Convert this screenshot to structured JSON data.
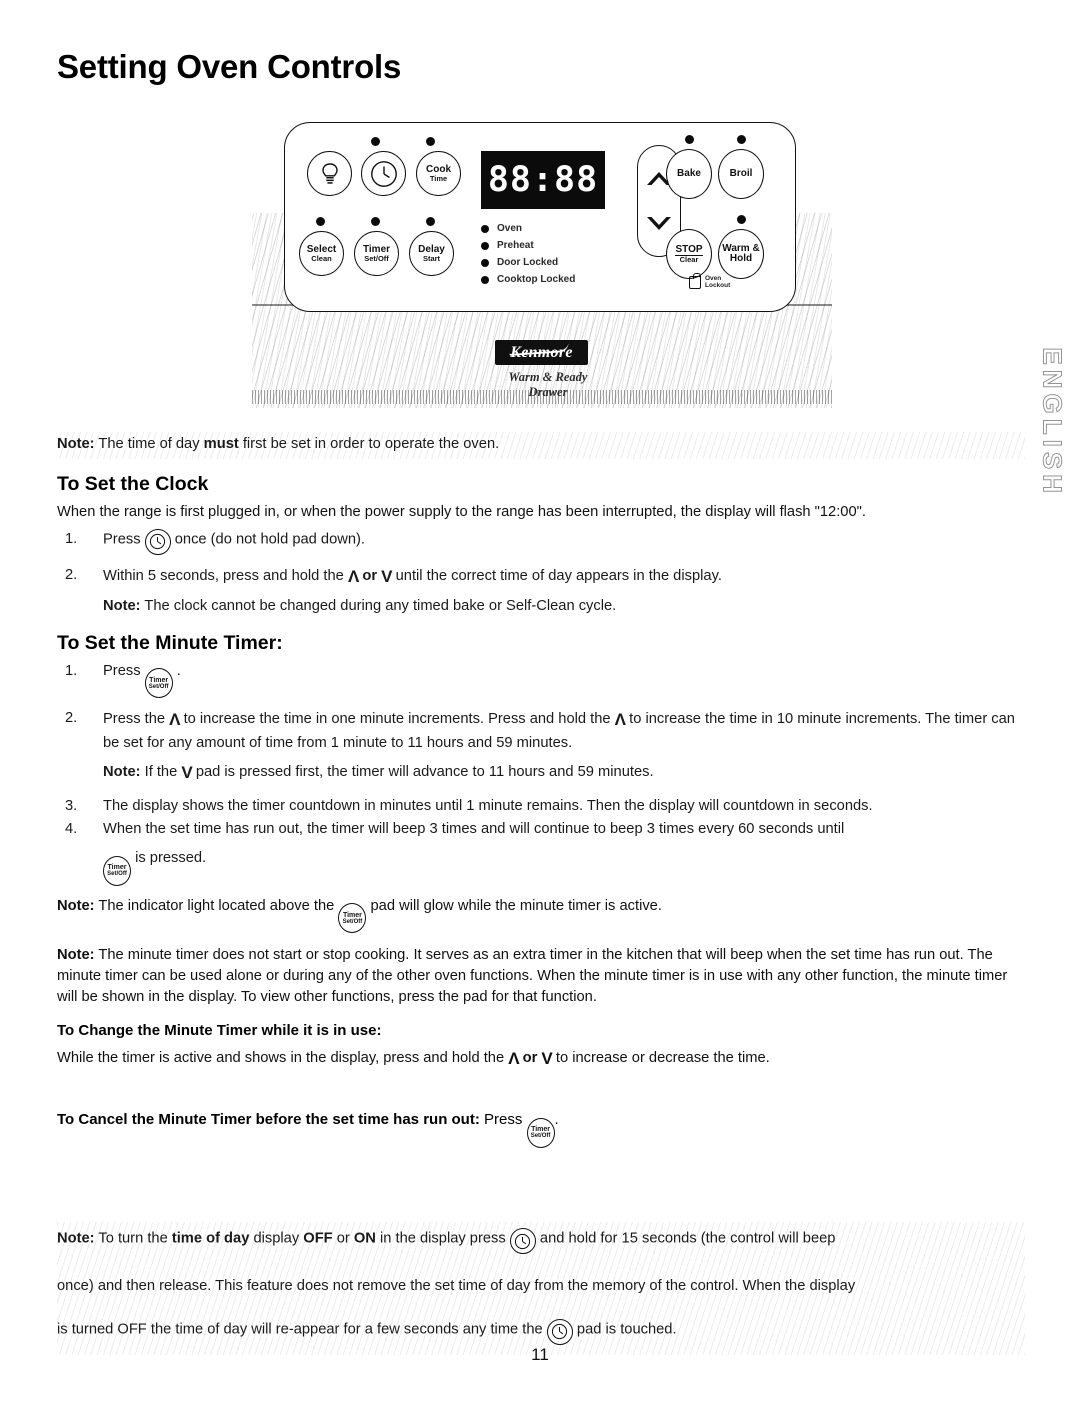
{
  "page": {
    "title": "Setting Oven Controls",
    "number": "11",
    "side_tab": "ENGLISH"
  },
  "control_panel": {
    "display_value": "88:88",
    "pads": {
      "light": "light-bulb-icon",
      "clock": "clock-icon",
      "cook_time_l1": "Cook",
      "cook_time_l2": "Time",
      "select_clean_l1": "Select",
      "select_clean_l2": "Clean",
      "timer_setoff_l1": "Timer",
      "timer_setoff_l2": "Set/Off",
      "delay_start_l1": "Delay",
      "delay_start_l2": "Start",
      "bake": "Bake",
      "broil": "Broil",
      "stop_l1": "STOP",
      "stop_l2": "Clear",
      "warm_hold_l1": "Warm &",
      "warm_hold_l2": "Hold"
    },
    "indicators": [
      "Oven",
      "Preheat",
      "Door Locked",
      "Cooktop Locked"
    ],
    "lockout_l1": "Oven",
    "lockout_l2": "Lockout",
    "brand": "Kenmore",
    "drawer_caption": "Warm & Ready Drawer"
  },
  "content": {
    "top_note_label": "Note:",
    "top_note_a": " The time of day ",
    "top_note_bold": "must",
    "top_note_b": " first be set in order to operate the oven.",
    "clock_heading": "To Set the Clock",
    "clock_intro": "When the range is first plugged in, or when the power supply to the range has been interrupted, the display will flash \"12:00\".",
    "clock_step1_num": "1.",
    "clock_step1_a": "Press",
    "clock_step1_b": "once (do not hold pad down).",
    "clock_step2_num": "2.",
    "clock_step2_a": "Within 5 seconds, press and hold the",
    "clock_step2_or": "or",
    "clock_step2_b": "until the correct time of day appears in the display.",
    "clock_step2_note_label": "Note:",
    "clock_step2_note": " The clock cannot be changed during any timed bake or Self-Clean cycle.",
    "timer_heading": "To Set the Minute Timer:",
    "timer_step1_num": "1.",
    "timer_step1_a": "Press",
    "timer_step1_b": ".",
    "timer_step2_num": "2.",
    "timer_step2_a": "Press the",
    "timer_step2_b": "to increase the time in one minute increments. Press and hold the",
    "timer_step2_c": "to increase the time in 10 minute increments. The timer can be set for any amount of time from 1 minute to 11 hours and 59 minutes.",
    "timer_step2_note_label": "Note:",
    "timer_step2_note_a": " If the",
    "timer_step2_note_b": "pad is pressed first, the timer will advance to 11 hours and 59 minutes.",
    "timer_step3_num": "3.",
    "timer_step3": "The display shows the timer countdown in minutes until 1 minute remains. Then the display will countdown in seconds.",
    "timer_step4_num": "4.",
    "timer_step4_a": "When the set time has run out, the timer will beep 3 times and will continue to beep 3 times every 60 seconds until",
    "timer_step4_b": "is pressed.",
    "note_indicator_label": "Note:",
    "note_indicator_a": " The indicator light located above the",
    "note_indicator_b": "pad will glow while the minute timer is active.",
    "note_minute_label": "Note:",
    "note_minute": " The minute timer does not start or stop cooking. It serves as an extra timer in the kitchen that will beep when the set time has run out. The minute timer can be used alone or during any of the other oven functions. When the minute timer is in use with any other function, the minute timer will be shown in the display. To view other functions, press the pad for that function.",
    "change_heading": "To Change the Minute Timer while it is in use:",
    "change_a": "While the timer is active and shows in the display, press and hold the",
    "change_or": "or",
    "change_b": "to increase or decrease the time.",
    "cancel_heading": "To Cancel the Minute Timer before the set time has run out:",
    "cancel_a": "Press",
    "cancel_b": ".",
    "bottom_note_label": "Note:",
    "bottom_note_a": " To turn the ",
    "bottom_note_bold1": "time of day",
    "bottom_note_b": " display ",
    "bottom_note_bold2": "OFF",
    "bottom_note_c": " or ",
    "bottom_note_bold3": "ON",
    "bottom_note_d": " in the display press",
    "bottom_note_e": "and hold for 15 seconds (the control will beep",
    "bottom_note_line2": "once) and then release. This feature does not remove the set time of day from the memory of the control. When the display",
    "bottom_note_line3_a": "is turned OFF the time of day will re-appear for a few seconds any time the",
    "bottom_note_line3_b": "pad is touched."
  },
  "glyphs": {
    "chevron_up": "Λ",
    "chevron_down": "V",
    "timer_pad_l1": "Timer",
    "timer_pad_l2": "Set/Off"
  }
}
